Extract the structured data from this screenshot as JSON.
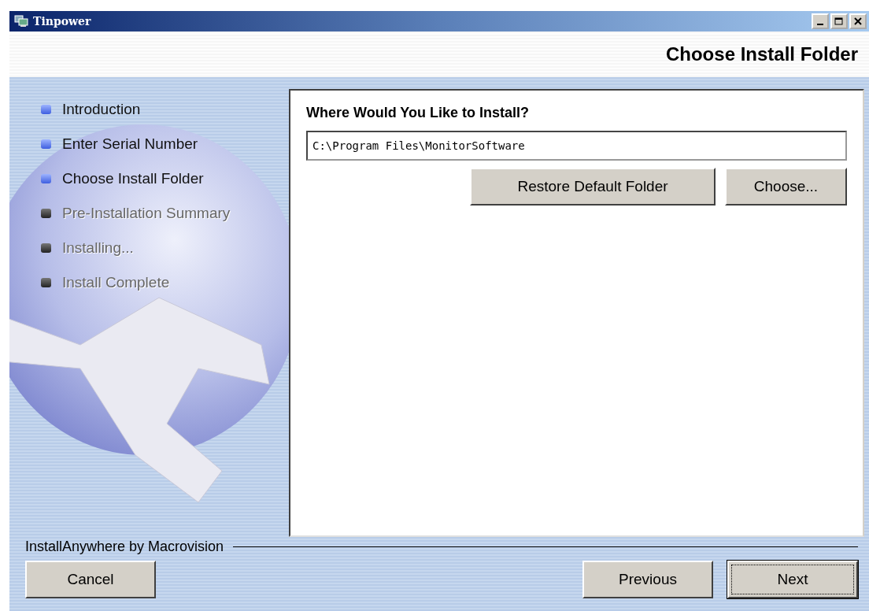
{
  "window": {
    "title": "Tinpower",
    "controls": [
      {
        "kind": "minimize"
      },
      {
        "kind": "maximize"
      },
      {
        "kind": "close"
      }
    ]
  },
  "header": {
    "title": "Choose Install Folder"
  },
  "steps": [
    {
      "label": "Introduction",
      "enabled": true
    },
    {
      "label": "Enter Serial Number",
      "enabled": true
    },
    {
      "label": "Choose Install Folder",
      "enabled": true
    },
    {
      "label": "Pre-Installation Summary",
      "enabled": false
    },
    {
      "label": "Installing...",
      "enabled": false
    },
    {
      "label": "Install Complete",
      "enabled": false
    }
  ],
  "panel": {
    "heading": "Where Would You Like to Install?",
    "path": "C:\\Program Files\\MonitorSoftware",
    "buttons": [
      {
        "label": "Restore Default Folder",
        "focused": false
      },
      {
        "label": "Choose...",
        "focused": false
      }
    ]
  },
  "footer": {
    "brand": "InstallAnywhere by Macrovision",
    "left_buttons": [
      {
        "label": "Cancel",
        "focused": false
      }
    ],
    "right_buttons": [
      {
        "label": "Previous",
        "focused": false
      },
      {
        "label": "Next",
        "focused": true
      }
    ]
  }
}
